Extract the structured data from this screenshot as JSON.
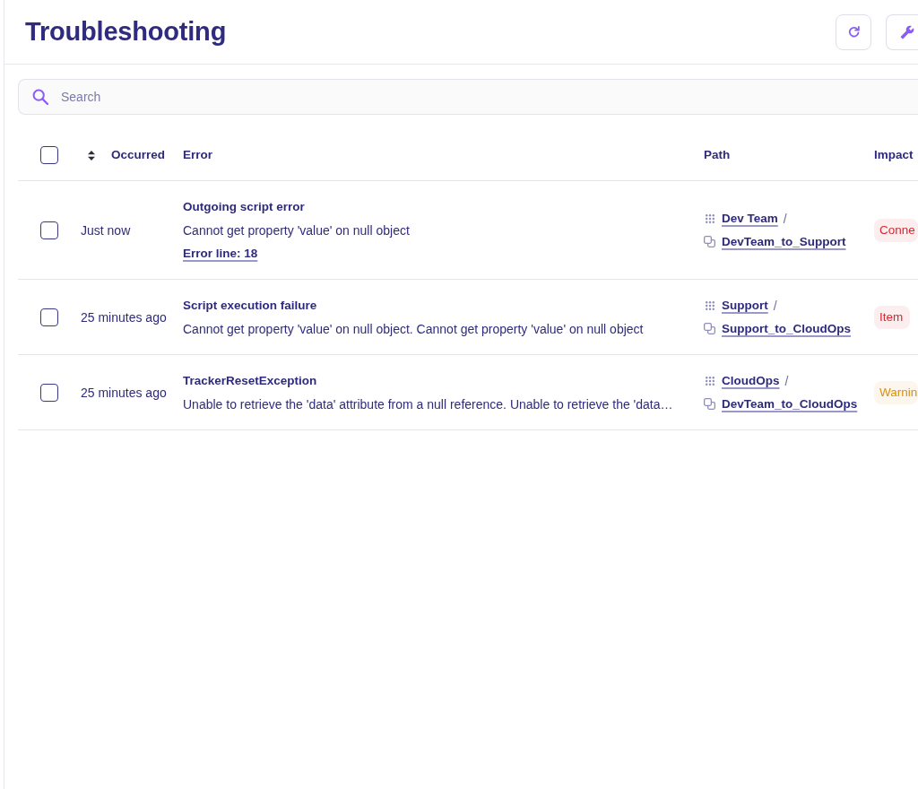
{
  "header": {
    "title": "Troubleshooting"
  },
  "search": {
    "placeholder": "Search"
  },
  "table": {
    "select_all": {
      "checked": false
    },
    "columns": [
      {
        "label": "Occurred",
        "sortable": true
      },
      {
        "label": "Error",
        "sortable": false
      },
      {
        "label": "Path",
        "sortable": false
      },
      {
        "label": "Impact",
        "sortable": false
      }
    ],
    "rows": [
      {
        "checked": false,
        "occurred": "Just now",
        "error": {
          "title": "Outgoing script error",
          "message": "Cannot get property 'value' on null object",
          "link": "Error line: 18"
        },
        "path": {
          "group": "Dev Team",
          "separator": "/",
          "item": "DevTeam_to_Support"
        },
        "impact": {
          "label": "Conne",
          "color": "#d7282f"
        }
      },
      {
        "checked": false,
        "occurred": "25 minutes ago",
        "error": {
          "title": "Script execution failure",
          "message": "Cannot get property 'value' on null object. Cannot get property 'value' on null object"
        },
        "path": {
          "group": "Support",
          "separator": "/",
          "item": "Support_to_CloudOps"
        },
        "impact": {
          "label": "Item",
          "color": "#d7282f"
        }
      },
      {
        "checked": false,
        "occurred": "25 minutes ago",
        "error": {
          "title": "TrackerResetException",
          "message": "Unable to retrieve the 'data' attribute from a null reference. Unable to retrieve the 'data…"
        },
        "path": {
          "group": "CloudOps",
          "separator": "/",
          "item": "DevTeam_to_CloudOps"
        },
        "impact": {
          "label": "Warnin",
          "color": "#d8900e"
        }
      }
    ]
  }
}
